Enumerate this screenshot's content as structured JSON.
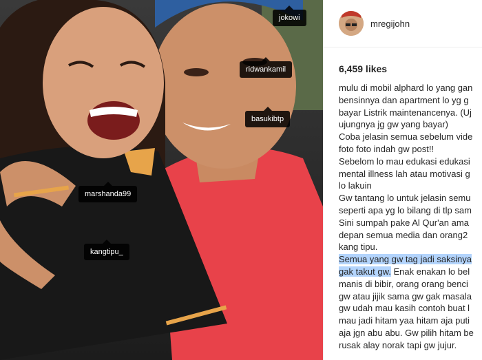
{
  "post": {
    "username": "mregijohn",
    "likes": "6,459 likes"
  },
  "tags": [
    "jokowi",
    "ridwankamil",
    "basukibtp",
    "marshanda99",
    "kangtipu_"
  ],
  "caption": {
    "lines": [
      "mulu di mobil alphard lo yang gan",
      "bensinnya dan apartment lo yg g",
      "bayar Listrik maintenancenya. (Uj",
      "ujungnya jg gw yang bayar)",
      "Coba jelasin semua sebelum vide",
      "foto foto indah gw post!!",
      "Sebelom lo mau edukasi edukasi",
      "mental illness lah atau motivasi g",
      "lo lakuin",
      "Gw tantang lo untuk jelasin semu",
      "seperti apa yg lo bilang di tlp sam",
      "Sini sumpah pake Al Qur'an ama",
      "depan semua media dan orang2",
      "kang tipu."
    ],
    "highlighted_1": "Semua yang gw tag jadi saksinya",
    "highlighted_2": "gak takut gw.",
    "after_highlight": " Enak enakan lo bel",
    "lines_tail": [
      "manis di bibir, orang orang benci",
      "gw atau jijik sama gw gak masala",
      "gw udah mau kasih contoh buat l",
      "mau jadi hitam yaa hitam aja puti",
      "aja jgn abu abu. Gw pilih hitam be",
      "rusak alay norak tapi gw jujur."
    ]
  },
  "colors": {
    "highlight": "#b3d4fc",
    "shirt_red": "#e8424a",
    "tag_bg": "#000000"
  }
}
